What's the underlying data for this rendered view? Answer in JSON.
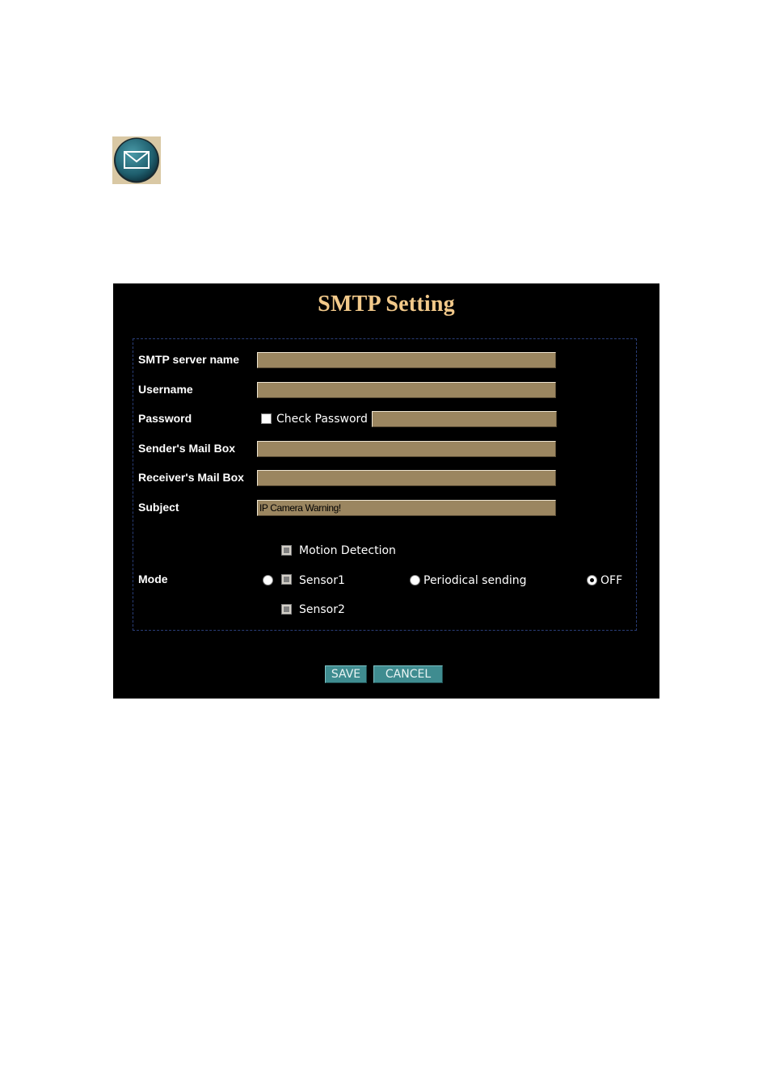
{
  "icon": {
    "name": "mail-icon"
  },
  "title": "SMTP Setting",
  "fields": {
    "smtp_server": {
      "label": "SMTP server name",
      "value": ""
    },
    "username": {
      "label": "Username",
      "value": ""
    },
    "password": {
      "label": "Password",
      "check_label": "Check Password",
      "value": ""
    },
    "sender": {
      "label": "Sender's Mail Box",
      "value": ""
    },
    "receiver": {
      "label": "Receiver's Mail Box",
      "value": ""
    },
    "subject": {
      "label": "Subject",
      "value": "IP Camera Warning!"
    }
  },
  "mode": {
    "label": "Mode",
    "motion_detection": "Motion Detection",
    "sensor1": "Sensor1",
    "sensor2": "Sensor2",
    "periodical": "Periodical sending",
    "off": "OFF",
    "selected": "off"
  },
  "buttons": {
    "save": "SAVE",
    "cancel": "CANCEL"
  },
  "colors": {
    "panel_bg": "#000000",
    "title": "#f2c98a",
    "field_bg": "#9b8660",
    "button_bg": "#3f8c90"
  }
}
